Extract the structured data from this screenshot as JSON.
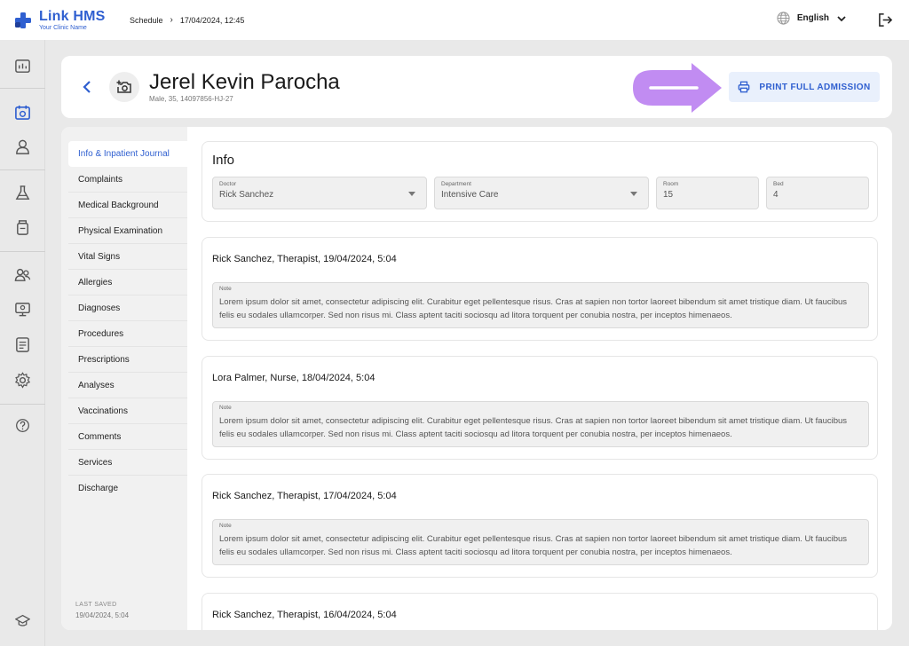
{
  "app": {
    "name": "Link HMS",
    "clinic": "Your Clinic Name"
  },
  "breadcrumb": {
    "section": "Schedule",
    "current": "17/04/2024, 12:45"
  },
  "language": {
    "selected": "English"
  },
  "patient": {
    "name": "Jerel Kevin Parocha",
    "info": "Male, 35, 14097856-HJ-27"
  },
  "actions": {
    "print_label": "PRINT FULL ADMISSION"
  },
  "nav": {
    "items": [
      {
        "label": "Info & Inpatient Journal"
      },
      {
        "label": "Complaints"
      },
      {
        "label": "Medical Background"
      },
      {
        "label": "Physical Examination"
      },
      {
        "label": "Vital Signs"
      },
      {
        "label": "Allergies"
      },
      {
        "label": "Diagnoses"
      },
      {
        "label": "Procedures"
      },
      {
        "label": "Prescriptions"
      },
      {
        "label": "Analyses"
      },
      {
        "label": "Vaccinations"
      },
      {
        "label": "Comments"
      },
      {
        "label": "Services"
      },
      {
        "label": "Discharge"
      }
    ],
    "last_saved_label": "LAST SAVED",
    "last_saved_value": "19/04/2024, 5:04"
  },
  "info": {
    "title": "Info",
    "doctor": {
      "label": "Doctor",
      "value": "Rick Sanchez"
    },
    "department": {
      "label": "Department",
      "value": "Intensive Care"
    },
    "room": {
      "label": "Room",
      "value": "15"
    },
    "bed": {
      "label": "Bed",
      "value": "4"
    }
  },
  "journal": [
    {
      "title": "Rick Sanchez, Therapist, 19/04/2024, 5:04",
      "note_label": "Note",
      "note": "Lorem ipsum dolor sit amet, consectetur adipiscing elit. Curabitur eget pellentesque risus. Cras at sapien non tortor laoreet bibendum sit amet tristique diam. Ut faucibus felis eu sodales ullamcorper. Sed non risus mi. Class aptent taciti sociosqu ad litora torquent per conubia nostra, per inceptos himenaeos."
    },
    {
      "title": "Lora Palmer, Nurse, 18/04/2024, 5:04",
      "note_label": "Note",
      "note": "Lorem ipsum dolor sit amet, consectetur adipiscing elit. Curabitur eget pellentesque risus. Cras at sapien non tortor laoreet bibendum sit amet tristique diam. Ut faucibus felis eu sodales ullamcorper. Sed non risus mi. Class aptent taciti sociosqu ad litora torquent per conubia nostra, per inceptos himenaeos."
    },
    {
      "title": "Rick Sanchez, Therapist, 17/04/2024, 5:04",
      "note_label": "Note",
      "note": "Lorem ipsum dolor sit amet, consectetur adipiscing elit. Curabitur eget pellentesque risus. Cras at sapien non tortor laoreet bibendum sit amet tristique diam. Ut faucibus felis eu sodales ullamcorper. Sed non risus mi. Class aptent taciti sociosqu ad litora torquent per conubia nostra, per inceptos himenaeos."
    },
    {
      "title": "Rick Sanchez, Therapist, 16/04/2024, 5:04"
    }
  ],
  "colors": {
    "accent": "#2f5fd0",
    "arrow": "#c18cf2",
    "button_bg": "#e9f0fc"
  },
  "icons": {
    "rail": [
      "dashboard-icon",
      "calendar-icon",
      "user-icon",
      "lab-flask-icon",
      "medicine-bottle-icon",
      "users-icon",
      "monitor-icon",
      "report-icon",
      "gear-icon",
      "help-icon",
      "graduation-cap-icon"
    ]
  }
}
